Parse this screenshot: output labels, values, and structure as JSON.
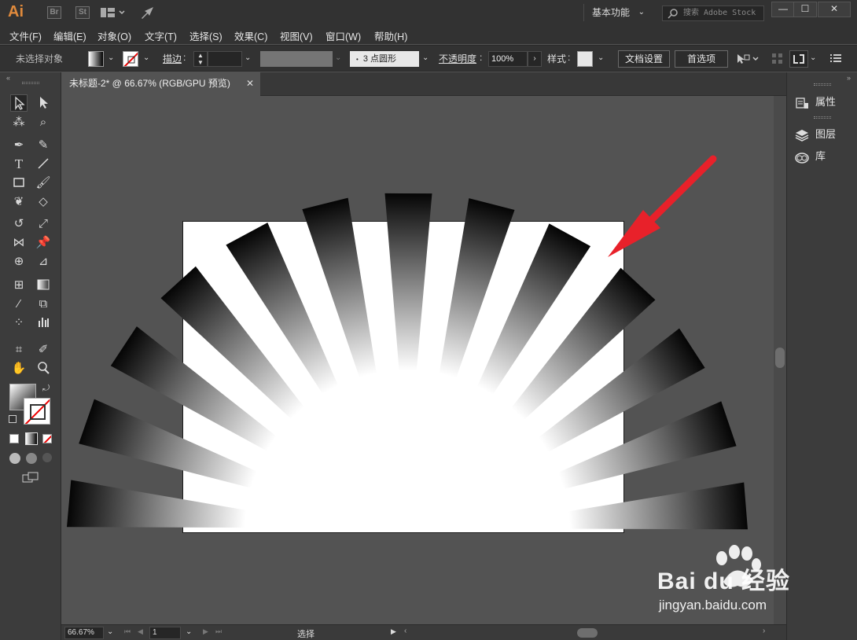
{
  "app": {
    "logo": "Ai",
    "bridge": "Br",
    "stock_app": "St",
    "workspace": "基本功能",
    "stock_search_placeholder": "搜索 Adobe Stock",
    "window_buttons": [
      "—",
      "☐",
      "✕"
    ]
  },
  "menu": [
    "文件(F)",
    "编辑(E)",
    "对象(O)",
    "文字(T)",
    "选择(S)",
    "效果(C)",
    "视图(V)",
    "窗口(W)",
    "帮助(H)"
  ],
  "control_bar": {
    "selection_state": "未选择对象",
    "stroke_label": "描边",
    "brush_value": "3 点圆形",
    "opacity_label": "不透明度",
    "opacity_value": "100%",
    "style_label": "样式",
    "doc_setup_button": "文档设置",
    "preferences_button": "首选项"
  },
  "document_tab": {
    "title": "未标题-2* @ 66.67% (RGB/GPU 预览)",
    "close": "✕"
  },
  "right_panel": {
    "items": [
      {
        "label": "属性",
        "icon": "properties-icon"
      },
      {
        "label": "图层",
        "icon": "layers-icon"
      },
      {
        "label": "库",
        "icon": "libraries-icon"
      }
    ]
  },
  "status_bar": {
    "zoom": "66.67%",
    "page": "1",
    "tool_status": "选择"
  },
  "watermark": {
    "brand": "Bai du 经验",
    "url": "jingyan.baidu.com"
  },
  "colors": {
    "ui_dark": "#323232",
    "ui_panel": "#3c3c3c",
    "canvas": "#535353",
    "arrow": "#e8212a",
    "logo": "#e08a3c"
  }
}
